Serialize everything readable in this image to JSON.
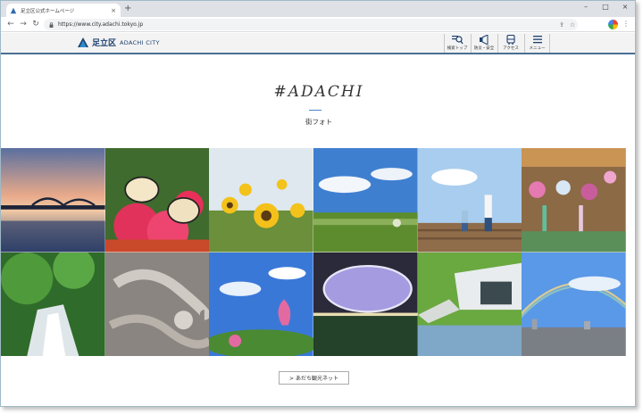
{
  "browser": {
    "tab_title": "足立区公式ホームページ",
    "url": "https://www.city.adachi.tokyo.jp"
  },
  "site": {
    "logo_jp": "足立区",
    "logo_en": "ADACHI CITY",
    "nav": [
      {
        "label": "検索トップ",
        "icon": "search-icon"
      },
      {
        "label": "防災・安全",
        "icon": "megaphone-icon"
      },
      {
        "label": "アクセス",
        "icon": "bus-icon"
      },
      {
        "label": "メニュー",
        "icon": "menu-icon"
      }
    ]
  },
  "hero": {
    "title": "#ADACHI",
    "subtitle": "街フォト"
  },
  "photos": [
    {
      "name": "bridge-sunset"
    },
    {
      "name": "butterflies-flowers"
    },
    {
      "name": "sunflowers"
    },
    {
      "name": "riverbank-field"
    },
    {
      "name": "parent-child-stairs"
    },
    {
      "name": "wind-chimes"
    },
    {
      "name": "waterfall-greenery"
    },
    {
      "name": "stone-dragon-carving"
    },
    {
      "name": "lotus-pond"
    },
    {
      "name": "ring-structure-night"
    },
    {
      "name": "modern-building-pond"
    },
    {
      "name": "rainbow-city"
    }
  ],
  "footer_link": "> あだち観光ネット",
  "colors": {
    "brand_navy": "#1c3f6e",
    "accent_blue": "#4a86c5"
  }
}
